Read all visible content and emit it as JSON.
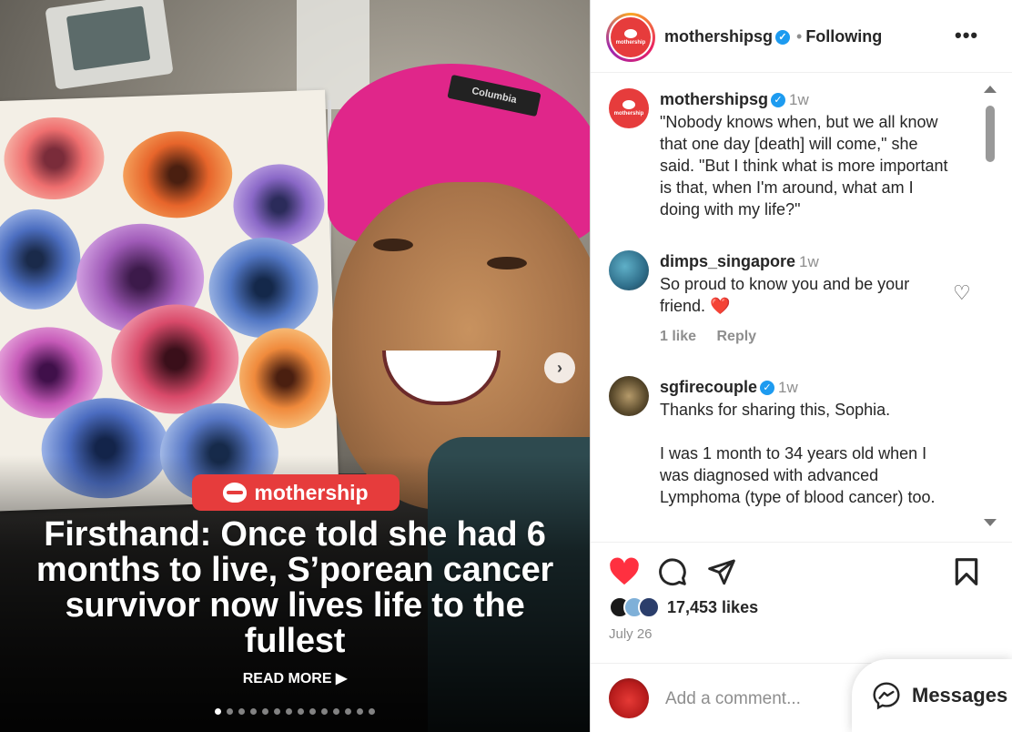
{
  "post": {
    "brand_pill": "mothership",
    "headline": "Firsthand: Once told she had 6 months to live, S’porean cancer survivor now lives life to the fullest",
    "read_more": "READ MORE ▶",
    "hat_label": "Columbia",
    "carousel_total": 14,
    "carousel_active": 0
  },
  "header": {
    "username": "mothershipsg",
    "separator": "•",
    "following_label": "Following",
    "more_label": "•••",
    "avatar_text": "mothership"
  },
  "comments": [
    {
      "username": "mothershipsg",
      "time": "1w",
      "verified": true,
      "text": "\"Nobody knows when, but we all know that one day [death] will come,\" she said. \"But I think what is more important is that, when I'm around, what am I doing with my life?\""
    },
    {
      "username": "dimps_singapore",
      "time": "1w",
      "verified": false,
      "text": "So proud to know you and be your friend. ❤️",
      "likes": "1 like",
      "reply": "Reply"
    },
    {
      "username": "sgfirecouple",
      "time": "1w",
      "verified": true,
      "text": "Thanks for sharing this, Sophia.\n\nI was 1 month to 34 years old when I was diagnosed with advanced Lymphoma (type of blood cancer) too."
    }
  ],
  "footer": {
    "likes": "17,453 likes",
    "date": "July 26",
    "add_comment_placeholder": "Add a comment...",
    "messages_label": "Messages"
  },
  "colors": {
    "like_red": "#ff3040",
    "brand_red": "#e63c3c",
    "verified_blue": "#1d9bf0"
  }
}
